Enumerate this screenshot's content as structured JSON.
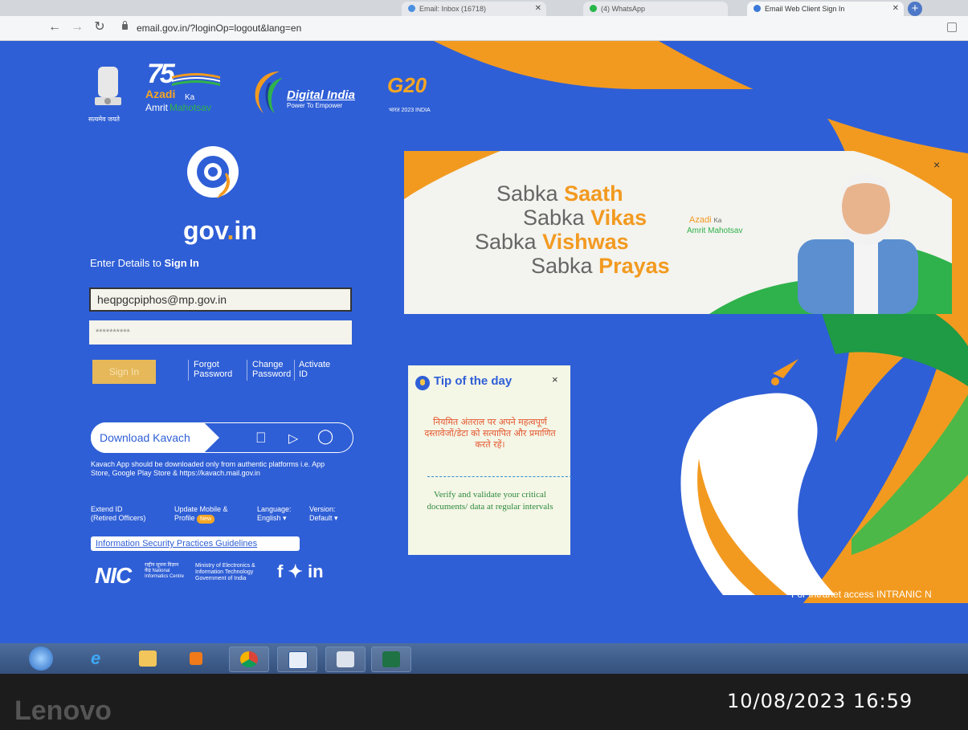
{
  "browser": {
    "tabs": [
      {
        "label": "Email: Inbox (16718)",
        "active": false
      },
      {
        "label": "(4) WhatsApp",
        "active": false
      },
      {
        "label": "Email Web Client Sign In",
        "active": true
      }
    ],
    "url": "email.gov.in/?loginOp=logout&lang=en"
  },
  "header_logos": {
    "emblem_caption": "सत्यमेव जयते",
    "amrit_75": "75",
    "amrit_azadi": "Azadi",
    "amrit_ka": "Ka",
    "amrit_amrit": "Amrit",
    "amrit_mahotsav": "Mahotsav",
    "digital_india_title": "Digital India",
    "digital_india_tagline": "Power To Empower",
    "g20": "G20",
    "g20_sub": "भारत 2023 INDIA"
  },
  "login": {
    "logo_text": "gov",
    "logo_dot": ".",
    "logo_suffix": "in",
    "heading_prefix": "Enter Details to ",
    "heading_bold": "Sign In",
    "username_value": "heqpgcpiphos@mp.gov.in",
    "password_value": "**********",
    "signin_label": "Sign In",
    "links": [
      {
        "line1": "Forgot",
        "line2": "Password"
      },
      {
        "line1": "Change",
        "line2": "Password"
      },
      {
        "line1": "Activate",
        "line2": "ID"
      }
    ]
  },
  "kavach": {
    "label": "Download Kavach",
    "note": "Kavach App should be downloaded only from authentic platforms i.e. App Store, Google Play Store & https://kavach.mail.gov.in"
  },
  "footer": {
    "extend_id": "Extend ID",
    "extend_sub": "(Retired Officers)",
    "update_mobile": "Update Mobile &",
    "update_profile": "Profile",
    "new_badge": "New",
    "language_label": "Language:",
    "language_value": "English",
    "version_label": "Version:",
    "version_value": "Default",
    "info_security": "Information Security Practices Guidelines",
    "nic": "NIC",
    "nic_small": "राष्ट्रीय सूचना विज्ञान केंद्र National Informatics Centre",
    "meity": "Ministry of Electronics & Information Technology Government of India",
    "social": "f  ♥  in"
  },
  "banner": {
    "lines": [
      {
        "prefix": "Sabka ",
        "bold": "Saath"
      },
      {
        "prefix": "Sabka ",
        "bold": "Vikas"
      },
      {
        "prefix": "Sabka ",
        "bold": "Vishwas"
      },
      {
        "prefix": "Sabka ",
        "bold": "Prayas"
      }
    ],
    "close": "×",
    "amrit_azadi": "Azadi",
    "amrit_ka": "Ka",
    "amrit_line": "Amrit Mahotsav"
  },
  "tip": {
    "title": "Tip of the day",
    "close": "×",
    "hindi": "नियमित अंतराल पर अपने महत्वपूर्ण दस्तावेजों/डेटा को सत्यापित और प्रमाणित करते रहें।",
    "english": "Verify and validate your critical documents/ data at regular intervals"
  },
  "intranet": "For Intranet access  INTRANIC  N",
  "device": {
    "brand": "Lenovo",
    "timestamp": "10/08/2023 16:59"
  },
  "colors": {
    "page_blue": "#2f5fd6",
    "accent_orange": "#f29a20",
    "green": "#2fb24b"
  }
}
